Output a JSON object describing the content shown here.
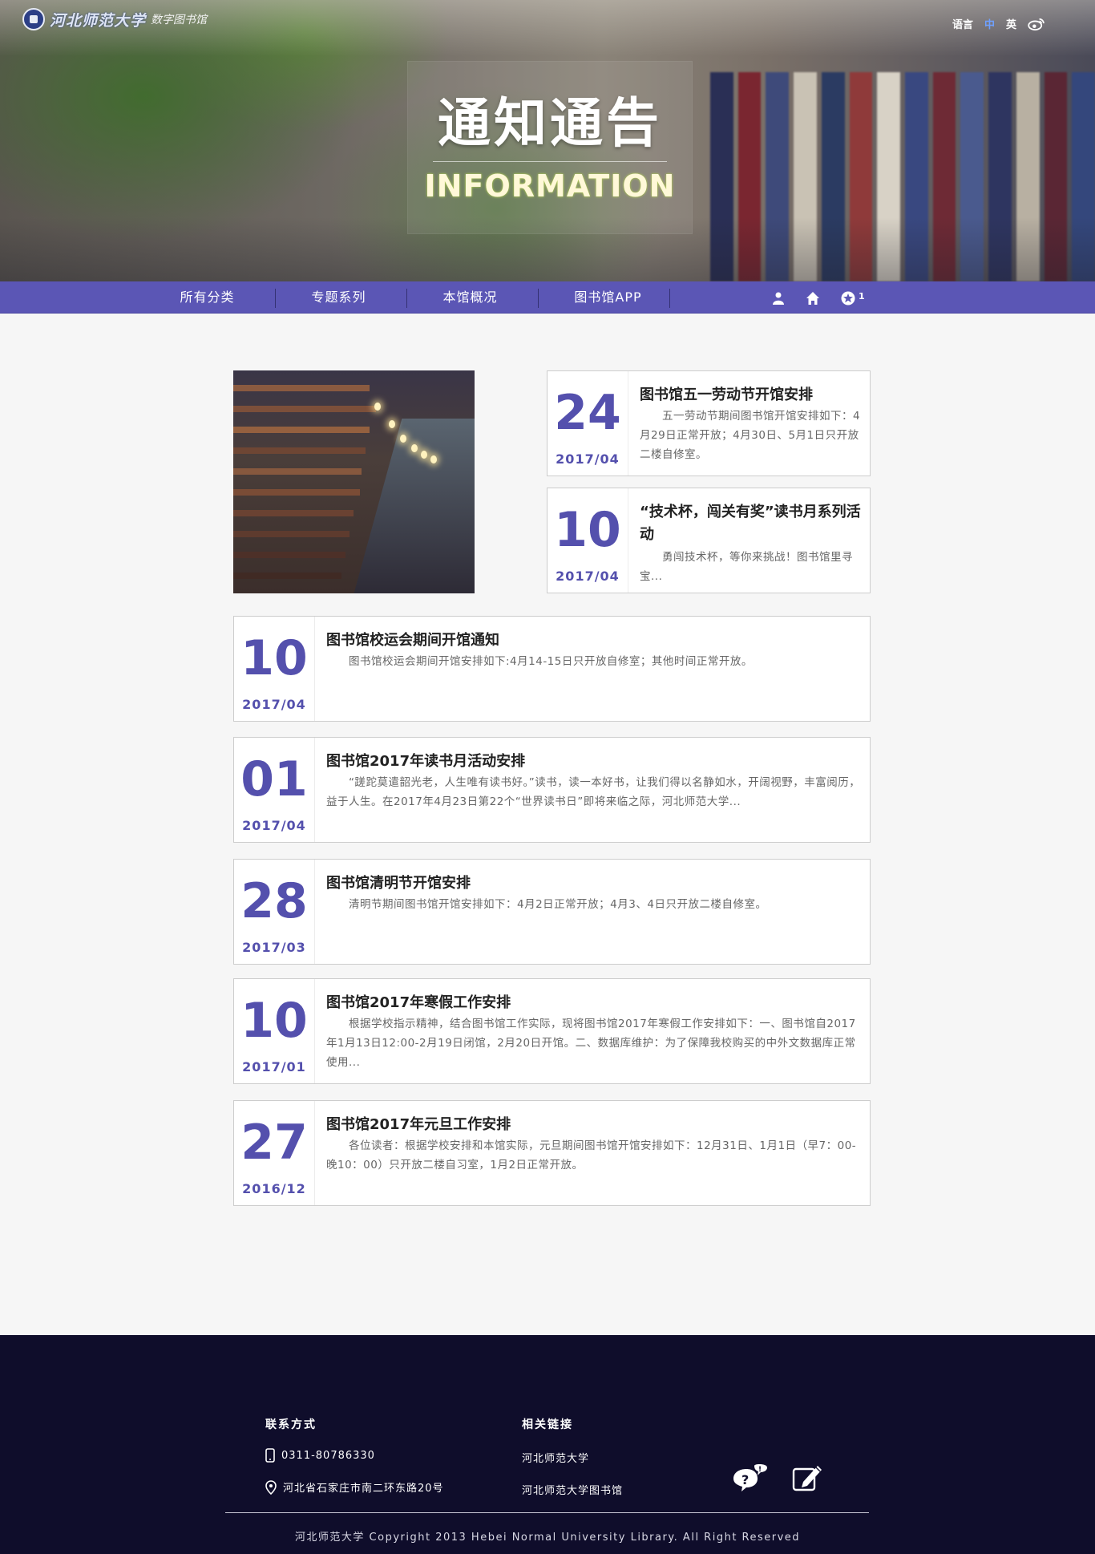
{
  "brand": {
    "school_name": "河北师范大学",
    "sub_name": "数字图书馆"
  },
  "lang": {
    "label": "语言",
    "zh": "中",
    "en": "英",
    "weibo_icon": "weibo-icon"
  },
  "hero": {
    "title": "通知通告",
    "subtitle": "INFORMATION"
  },
  "nav": {
    "items": [
      {
        "label": "所有分类"
      },
      {
        "label": "专题系列"
      },
      {
        "label": "本馆概况"
      },
      {
        "label": "图书馆APP"
      }
    ],
    "icons": [
      "user-icon",
      "home-icon",
      "star-badge-icon"
    ],
    "badge_count": "1"
  },
  "featured": [
    {
      "day": "24",
      "ym": "2017/04",
      "title": "图书馆五一劳动节开馆安排",
      "text": "　　五一劳动节期间图书馆开馆安排如下：4月29日正常开放；4月30日、5月1日只开放二楼自修室。"
    },
    {
      "day": "10",
      "ym": "2017/04",
      "title": "“技术杯，闯关有奖”读书月系列活动",
      "text": "　　勇闯技术杯，等你来挑战！图书馆里寻宝..."
    }
  ],
  "notices": [
    {
      "day": "10",
      "ym": "2017/04",
      "title": "图书馆校运会期间开馆通知",
      "text": "　　图书馆校运会期间开馆安排如下:4月14-15日只开放自修室；其他时间正常开放。"
    },
    {
      "day": "01",
      "ym": "2017/04",
      "title": "图书馆2017年读书月活动安排",
      "text": "　　“蹉跎莫遣韶光老，人生唯有读书好。”读书，读一本好书，让我们得以名静如水，开阔视野，丰富阅历，益于人生。在2017年4月23日第22个“世界读书日”即将来临之际，河北师范大学..."
    },
    {
      "day": "28",
      "ym": "2017/03",
      "title": "图书馆清明节开馆安排",
      "text": "　　清明节期间图书馆开馆安排如下：4月2日正常开放；4月3、4日只开放二楼自修室。"
    },
    {
      "day": "10",
      "ym": "2017/01",
      "title": "图书馆2017年寒假工作安排",
      "text": "　　根据学校指示精神，结合图书馆工作实际，现将图书馆2017年寒假工作安排如下：一、图书馆自2017年1月13日12:00-2月19日闭馆，2月20日开馆。二、数据库维护：为了保障我校购买的中外文数据库正常使用..."
    },
    {
      "day": "27",
      "ym": "2016/12",
      "title": "图书馆2017年元旦工作安排",
      "text": "　　各位读者：根据学校安排和本馆实际，元旦期间图书馆开馆安排如下：12月31日、1月1日（早7：00-晚10：00）只开放二楼自习室，1月2日正常开放。"
    }
  ],
  "footer": {
    "contact_heading": "联系方式",
    "phone": "0311-80786330",
    "address": "河北省石家庄市南二环东路20号",
    "links_heading": "相关链接",
    "links": [
      "河北师范大学",
      "河北师范大学图书馆"
    ],
    "copyright": "河北师范大学 Copyright 2013 Hebei Normal University Library. All Right Reserved",
    "icons": [
      "help-chat-icon",
      "edit-note-icon"
    ]
  },
  "colors": {
    "accent": "#5450ad",
    "nav_bg": "#5b56b5",
    "footer_bg": "#0f0d2b"
  }
}
